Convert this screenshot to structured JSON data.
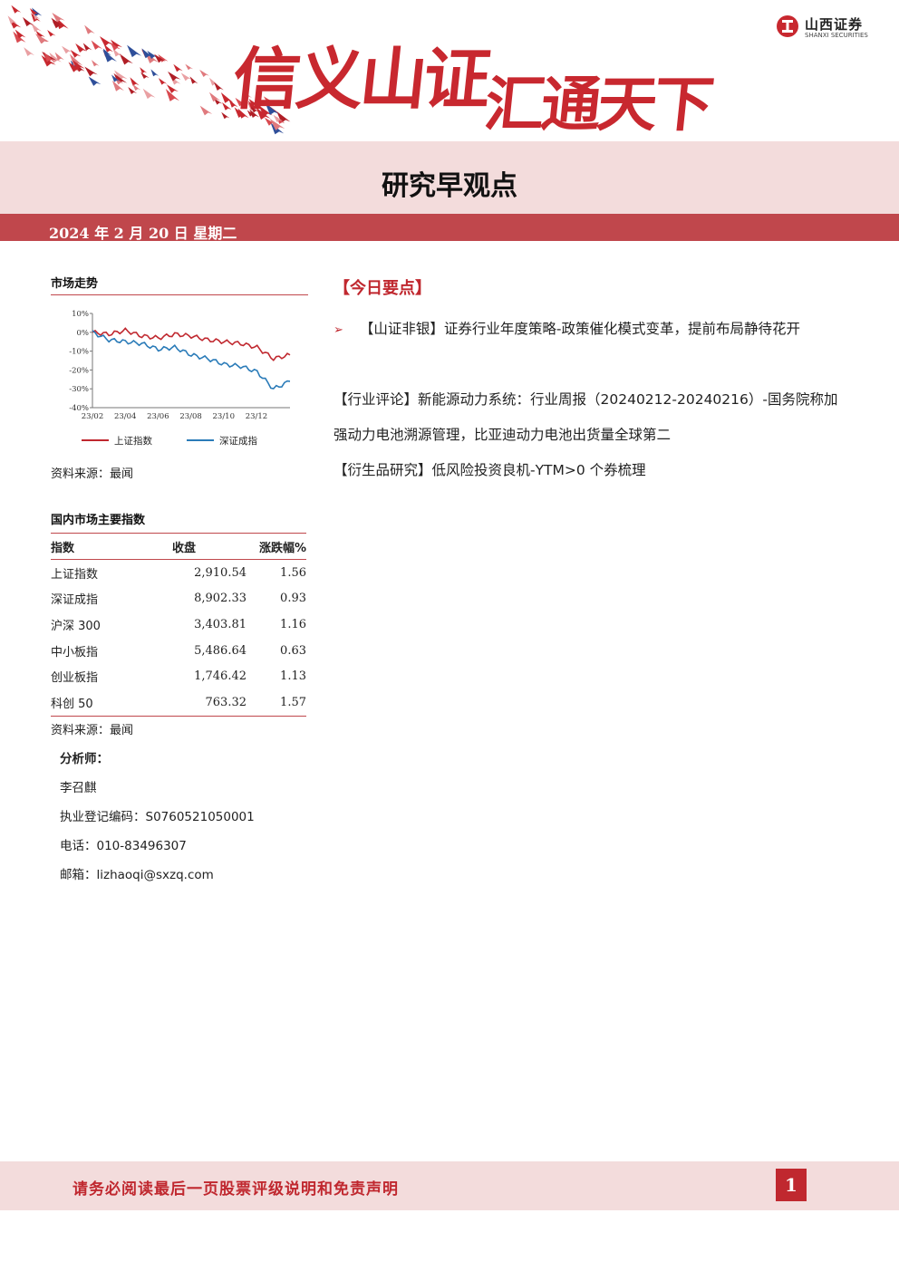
{
  "banner": {
    "slogan_part1": "信义山证",
    "slogan_part2": "汇通天下",
    "logo_cn": "山西证券",
    "logo_en": "SHANXI SECURITIES"
  },
  "title": "研究早观点",
  "date": "2024 年 2 月 20 日   星期二",
  "market_trend": {
    "heading": "市场走势",
    "source": "资料来源：最闻",
    "chart_data": {
      "type": "line",
      "title": "",
      "x_ticks": [
        "23/02",
        "23/04",
        "23/06",
        "23/08",
        "23/10",
        "23/12"
      ],
      "y_ticks": [
        "10%",
        "0%",
        "-10%",
        "-20%",
        "-30%",
        "-40%"
      ],
      "ylim": [
        -40,
        10
      ],
      "x": [
        "23/02",
        "23/03",
        "23/04",
        "23/05",
        "23/06",
        "23/07",
        "23/08",
        "23/09",
        "23/10",
        "23/11",
        "23/12",
        "24/01",
        "24/02"
      ],
      "series": [
        {
          "name": "上证指数",
          "color": "#c0282f",
          "values": [
            0,
            -1,
            1,
            -2,
            -3,
            -1,
            -2,
            -4,
            -5,
            -6,
            -8,
            -14,
            -12
          ]
        },
        {
          "name": "深证成指",
          "color": "#2a7bb8",
          "values": [
            0,
            -4,
            -5,
            -6,
            -9,
            -8,
            -12,
            -14,
            -17,
            -18,
            -21,
            -30,
            -26
          ]
        }
      ],
      "grid": false,
      "legend": "bottom"
    }
  },
  "indices": {
    "heading": "国内市场主要指数",
    "columns": [
      "指数",
      "收盘",
      "涨跌幅%"
    ],
    "rows": [
      [
        "上证指数",
        "2,910.54",
        "1.56"
      ],
      [
        "深证成指",
        "8,902.33",
        "0.93"
      ],
      [
        "沪深 300",
        "3,403.81",
        "1.16"
      ],
      [
        "中小板指",
        "5,486.64",
        "0.63"
      ],
      [
        "创业板指",
        "1,746.42",
        "1.13"
      ],
      [
        "科创 50",
        "763.32",
        "1.57"
      ]
    ],
    "source": "资料来源：最闻"
  },
  "analyst": {
    "label": "分析师：",
    "name": "李召麒",
    "reg": "执业登记编码：S0760521050001",
    "phone": "电话：010-83496307",
    "email": "邮箱：lizhaoqi@sxzq.com"
  },
  "highlights": {
    "heading": "【今日要点】",
    "items": [
      "【山证非银】证券行业年度策略-政策催化模式变革，提前布局静待花开",
      "【行业评论】新能源动力系统：行业周报（20240212-20240216）-国务院称加强动力电池溯源管理，比亚迪动力电池出货量全球第二",
      "【衍生品研究】低风险投资良机-YTM>0 个券梳理"
    ]
  },
  "footer": {
    "note": "请务必阅读最后一页股票评级说明和免责声明",
    "page": "1"
  }
}
